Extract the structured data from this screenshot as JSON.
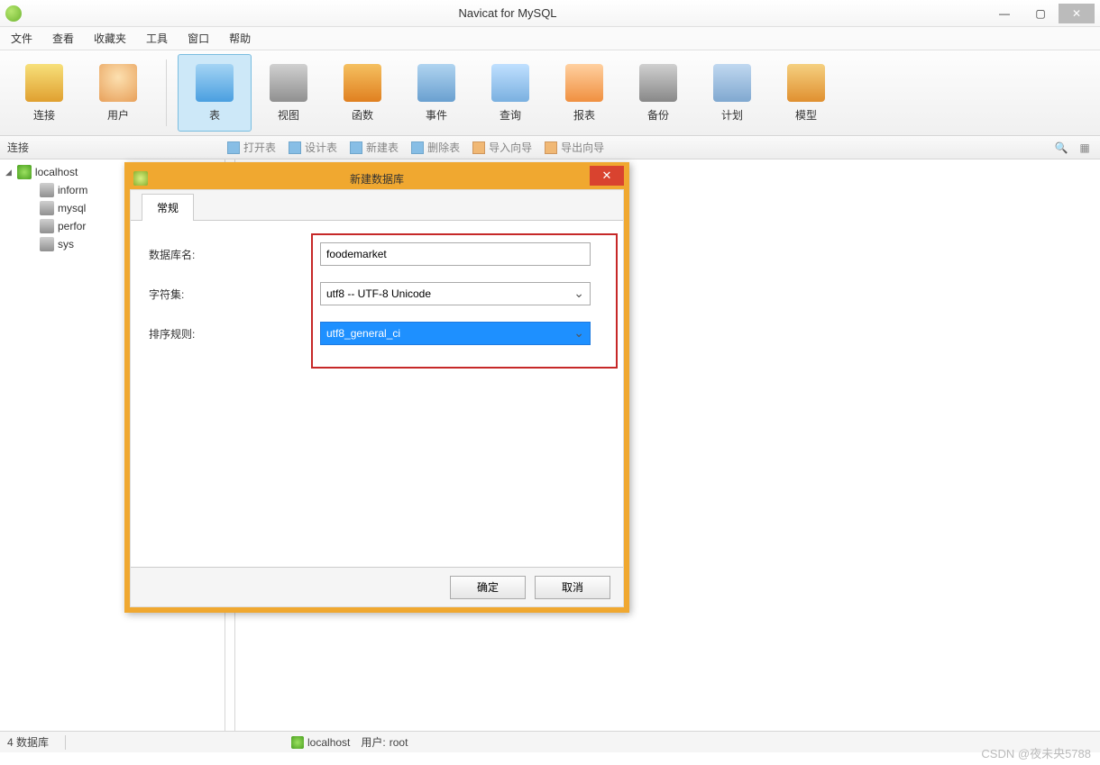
{
  "window": {
    "title": "Navicat for MySQL"
  },
  "menu": {
    "file": "文件",
    "view": "查看",
    "fav": "收藏夹",
    "tools": "工具",
    "window": "窗口",
    "help": "帮助"
  },
  "bigbar": {
    "conn": "连接",
    "user": "用户",
    "table": "表",
    "view": "视图",
    "func": "函数",
    "event": "事件",
    "query": "查询",
    "report": "报表",
    "backup": "备份",
    "plan": "计划",
    "model": "模型"
  },
  "toolbar2": {
    "label": "连接",
    "open": "打开表",
    "design": "设计表",
    "new": "新建表",
    "delete": "删除表",
    "importw": "导入向导",
    "exportw": "导出向导"
  },
  "tree": {
    "root": "localhost",
    "items": [
      "inform",
      "mysql",
      "perfor",
      "sys"
    ]
  },
  "dialog": {
    "title": "新建数据库",
    "tab": "常规",
    "labels": {
      "dbname": "数据库名:",
      "charset": "字符集:",
      "collation": "排序规则:"
    },
    "values": {
      "dbname": "foodemarket",
      "charset": "utf8 -- UTF-8 Unicode",
      "collation": "utf8_general_ci"
    },
    "buttons": {
      "ok": "确定",
      "cancel": "取消"
    }
  },
  "status": {
    "count": "4 数据库",
    "host": "localhost",
    "userlabel": "用户:",
    "user": "root"
  },
  "watermark": "CSDN @夜未央5788"
}
